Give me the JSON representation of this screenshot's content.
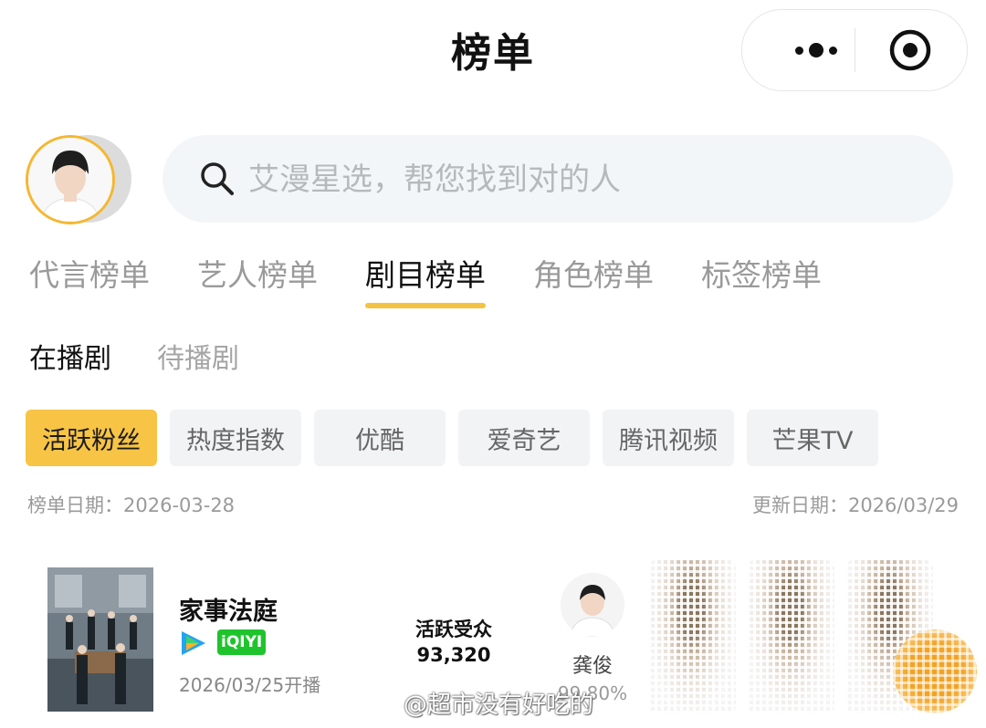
{
  "header": {
    "title": "榜单",
    "more_icon": "more-dots-icon",
    "target_icon": "target-icon"
  },
  "search": {
    "placeholder": "艾漫星选，帮您找到对的人",
    "icon": "search-icon"
  },
  "tabs": [
    {
      "label": "代言榜单",
      "active": false
    },
    {
      "label": "艺人榜单",
      "active": false
    },
    {
      "label": "剧目榜单",
      "active": true
    },
    {
      "label": "角色榜单",
      "active": false
    },
    {
      "label": "标签榜单",
      "active": false
    }
  ],
  "subtabs": [
    {
      "label": "在播剧",
      "active": true
    },
    {
      "label": "待播剧",
      "active": false
    }
  ],
  "chips": [
    {
      "label": "活跃粉丝",
      "active": true
    },
    {
      "label": "热度指数",
      "active": false
    },
    {
      "label": "优酷",
      "active": false
    },
    {
      "label": "爱奇艺",
      "active": false
    },
    {
      "label": "腾讯视频",
      "active": false
    },
    {
      "label": "芒果TV",
      "active": false
    }
  ],
  "dates": {
    "list_date": "榜单日期：2026-03-28",
    "update_date": "更新日期：2026/03/29"
  },
  "entry": {
    "title": "家事法庭",
    "air_date": "2026/03/25开播",
    "platforms": [
      "tencent-video-icon",
      "iqiyi-icon"
    ],
    "iqiyi_text": "iQIYI",
    "metric_label": "活跃受众",
    "metric_value": "93,320",
    "actor": {
      "name": "龚俊",
      "score": "99.80%"
    }
  },
  "watermark": "@超市没有好吃的",
  "colors": {
    "accent": "#f7c446",
    "underline": "#f5c342",
    "avatar_ring": "#f5b731"
  }
}
